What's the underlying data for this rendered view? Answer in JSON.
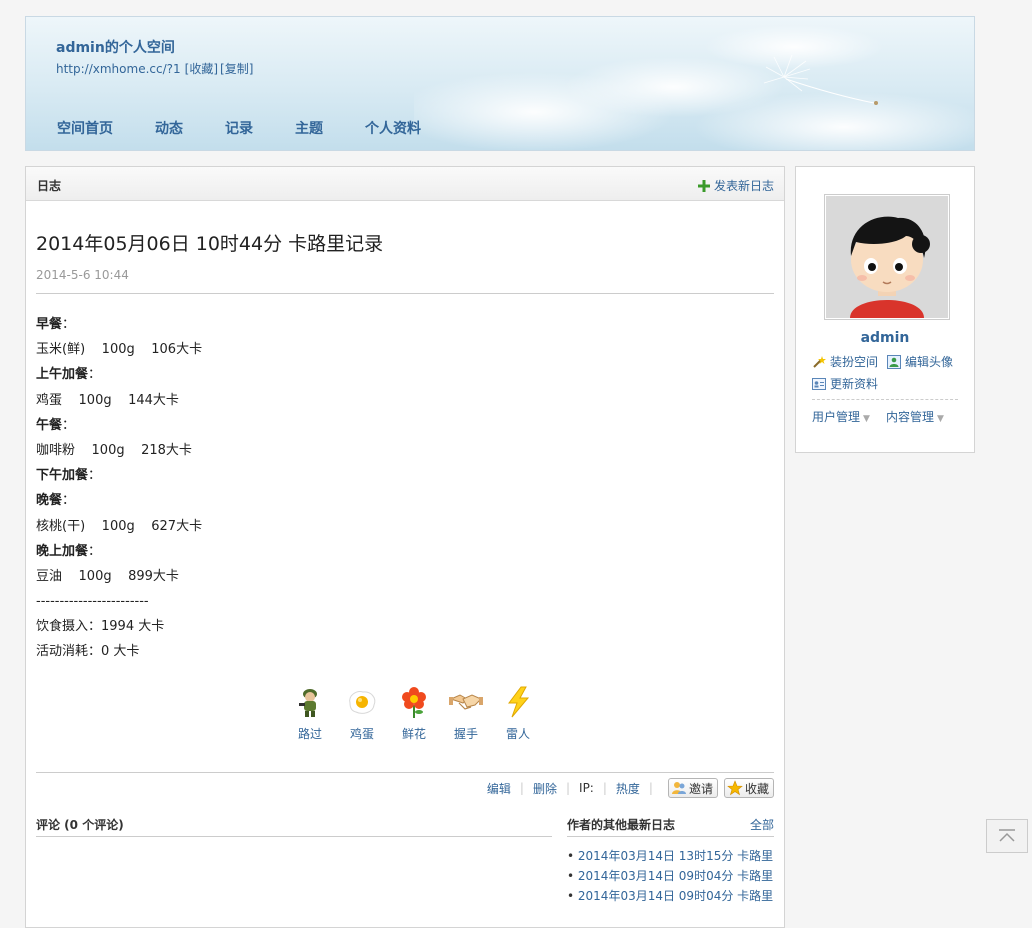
{
  "header": {
    "space_title": "admin的个人空间",
    "space_url": "http://xmhome.cc/?1",
    "collect_label": "[收藏]",
    "copy_label": "[复制]",
    "nav": [
      "空间首页",
      "动态",
      "记录",
      "主题",
      "个人资料"
    ]
  },
  "main": {
    "bar_title": "日志",
    "new_post_label": "发表新日志",
    "post": {
      "title": "2014年05月06日 10时44分 卡路里记录",
      "date": "2014-5-6 10:44",
      "lines": [
        {
          "bold": "早餐",
          "text": "："
        },
        {
          "bold": "",
          "text": "玉米(鲜)    100g    106大卡"
        },
        {
          "bold": "上午加餐",
          "text": "："
        },
        {
          "bold": "",
          "text": "鸡蛋    100g    144大卡"
        },
        {
          "bold": "午餐",
          "text": "："
        },
        {
          "bold": "",
          "text": "咖啡粉    100g    218大卡"
        },
        {
          "bold": "下午加餐",
          "text": "："
        },
        {
          "bold": "晚餐",
          "text": "："
        },
        {
          "bold": "",
          "text": "核桃(干)    100g    627大卡"
        },
        {
          "bold": "晚上加餐",
          "text": "："
        },
        {
          "bold": "",
          "text": "豆油    100g    899大卡"
        },
        {
          "bold": "",
          "text": "------------------------"
        },
        {
          "bold": "",
          "text": "饮食摄入：1994 大卡"
        },
        {
          "bold": "",
          "text": "活动消耗：0 大卡"
        }
      ]
    },
    "reactions": [
      {
        "label": "路过",
        "icon": "soldier-icon"
      },
      {
        "label": "鸡蛋",
        "icon": "egg-icon"
      },
      {
        "label": "鲜花",
        "icon": "flower-icon"
      },
      {
        "label": "握手",
        "icon": "handshake-icon"
      },
      {
        "label": "雷人",
        "icon": "lightning-icon"
      }
    ],
    "actions": {
      "edit": "编辑",
      "delete": "删除",
      "ip": "IP:",
      "heat": "热度",
      "invite": "邀请",
      "favorite": "收藏"
    },
    "comments_title": "评论 (0 个评论)",
    "others": {
      "title": "作者的其他最新日志",
      "all_label": "全部",
      "items": [
        "2014年03月14日 13时15分 卡路里",
        "2014年03月14日 09时04分 卡路里",
        "2014年03月14日 09时04分 卡路里"
      ]
    }
  },
  "sidebar": {
    "username": "admin",
    "dress_label": "装扮空间",
    "edit_avatar_label": "编辑头像",
    "update_profile_label": "更新资料",
    "user_manage_label": "用户管理",
    "content_manage_label": "内容管理"
  },
  "colors": {
    "link": "#336699",
    "header_sky": "#c3deec"
  }
}
